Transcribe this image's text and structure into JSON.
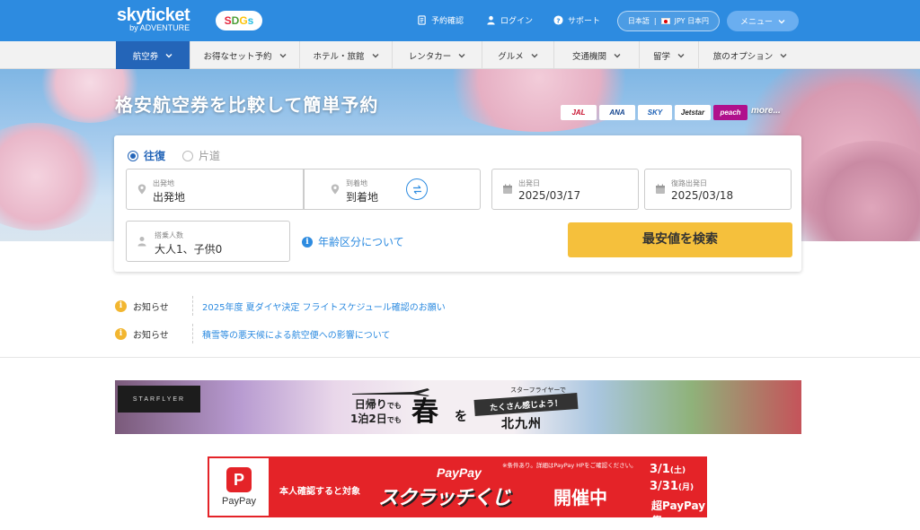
{
  "header": {
    "logo_main": "skyticket",
    "logo_sub": "by ADVENTURE",
    "sdgs_letters": [
      "S",
      "D",
      "G",
      "s"
    ],
    "links": {
      "reservation": "予約確認",
      "login": "ログイン",
      "support": "サポート"
    },
    "language": "日本語",
    "currency": "JPY 日本円",
    "menu": "メニュー"
  },
  "nav": {
    "items": [
      {
        "label": "航空券"
      },
      {
        "label": "お得なセット予約"
      },
      {
        "label": "ホテル・旅館"
      },
      {
        "label": "レンタカー"
      },
      {
        "label": "グルメ"
      },
      {
        "label": "交通機関"
      },
      {
        "label": "留学"
      },
      {
        "label": "旅のオプション"
      }
    ]
  },
  "hero": {
    "title": "格安航空券を比較して簡単予約",
    "airlines": [
      "JAL",
      "ANA",
      "SKY",
      "Jetstar",
      "peach"
    ],
    "more": "more..."
  },
  "search": {
    "trip_types": [
      "往復",
      "片道"
    ],
    "selected_trip_type": "往復",
    "origin_label": "出発地",
    "origin_value": "出発地",
    "destination_label": "到着地",
    "destination_value": "到着地",
    "depart_label": "出発日",
    "depart_value": "2025/03/17",
    "return_label": "復路出発日",
    "return_value": "2025/03/18",
    "passengers_label": "搭乗人数",
    "passengers_value": "大人1、子供0",
    "age_link": "年齢区分について",
    "submit": "最安値を検索"
  },
  "notices": [
    {
      "tag": "お知らせ",
      "text": "2025年度 夏ダイヤ決定 フライトスケジュール確認のお願い"
    },
    {
      "tag": "お知らせ",
      "text": "積雪等の悪天候による航空便への影響について"
    }
  ],
  "banner_starflyer": {
    "logo": "STARFLYER",
    "line1_main": "日帰り",
    "line1_suffix": "でも",
    "line2_main": "1泊2日",
    "line2_suffix": "でも",
    "haru": "春",
    "wo": "を",
    "small": "スターフライヤーで",
    "ribbon": "たくさん感じよう！",
    "place": "北九州"
  },
  "banner_paypay": {
    "brand": "PayPay",
    "icon_letter": "P",
    "confirm_text": "本人確認すると対象",
    "note": "※条件あり。詳細はPayPay HPをご確認ください。",
    "pp_title": "PayPay",
    "scratch": "スクラッチくじ",
    "kaisai": "開催中",
    "date1": "3/1",
    "date1_day": "(土)",
    "date2": "3/31",
    "date2_day": "(月)",
    "cho": "超PayPay祭"
  },
  "colors": {
    "header_blue": "#2d8be0",
    "nav_active": "#2465b8",
    "search_button": "#f5c03c",
    "notice_icon": "#f2b630",
    "paypay_red": "#e42328"
  }
}
